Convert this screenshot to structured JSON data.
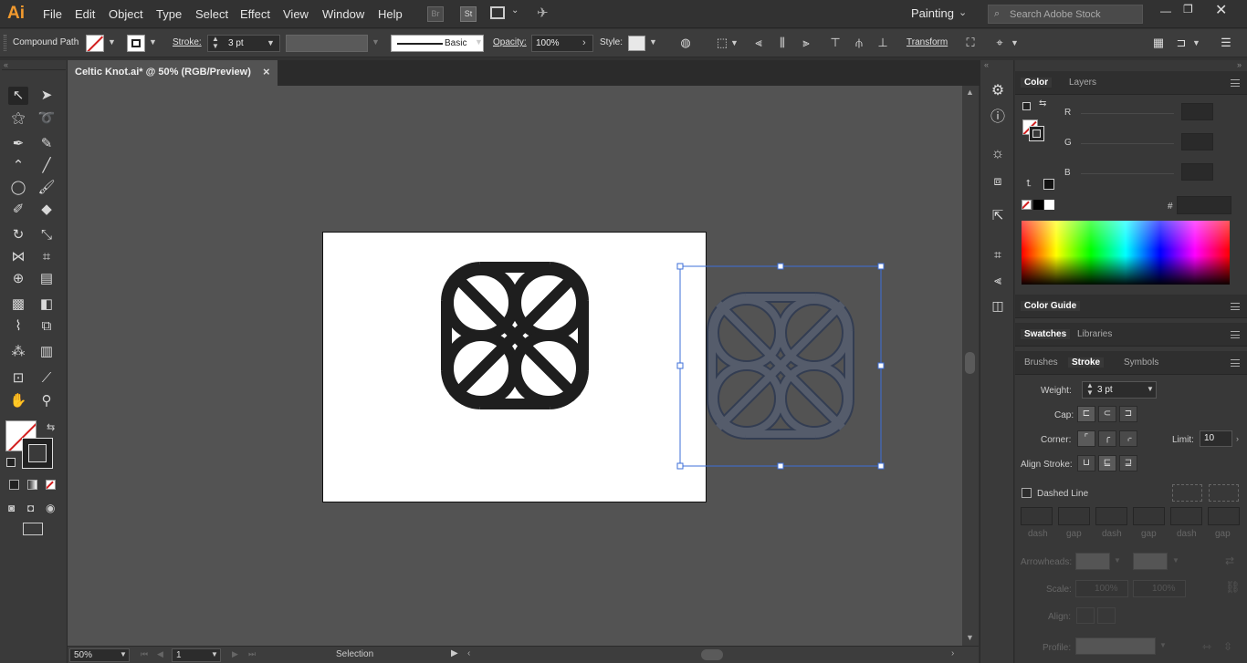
{
  "menubar": {
    "app_logo": "Ai",
    "items": [
      "File",
      "Edit",
      "Object",
      "Type",
      "Select",
      "Effect",
      "View",
      "Window",
      "Help"
    ],
    "workspace": "Painting",
    "stock_search_placeholder": "Search Adobe Stock"
  },
  "controlbar": {
    "selection_type": "Compound Path",
    "stroke_label": "Stroke:",
    "stroke_weight": "3 pt",
    "brush_profile": "Basic",
    "opacity_label": "Opacity:",
    "opacity_value": "100%",
    "style_label": "Style:",
    "transform_label": "Transform"
  },
  "document": {
    "tab_title": "Celtic Knot.ai* @ 50% (RGB/Preview)",
    "close_glyph": "×"
  },
  "statusbar": {
    "zoom": "50%",
    "artboard_number": "1",
    "status_text": "Selection"
  },
  "color_panel": {
    "tabs": [
      "Color",
      "Layers"
    ],
    "channels": [
      "R",
      "G",
      "B"
    ],
    "hex_label": "#"
  },
  "color_guide_panel": {
    "title": "Color Guide"
  },
  "swatches_panel": {
    "tabs": [
      "Swatches",
      "Libraries"
    ]
  },
  "stroke_panel": {
    "tabs": [
      "Brushes",
      "Stroke",
      "Symbols"
    ],
    "weight_label": "Weight:",
    "weight_value": "3 pt",
    "cap_label": "Cap:",
    "corner_label": "Corner:",
    "limit_label": "Limit:",
    "limit_value": "10",
    "align_label": "Align Stroke:",
    "dashed_label": "Dashed Line",
    "dash_gap_labels": [
      "dash",
      "gap",
      "dash",
      "gap",
      "dash",
      "gap"
    ],
    "arrowheads_label": "Arrowheads:",
    "scale_label": "Scale:",
    "scale_values": [
      "100%",
      "100%"
    ],
    "align_arrow_label": "Align:",
    "profile_label": "Profile:"
  },
  "colors": {
    "accent_logo": "#f29a2e",
    "selection_blue": "#3d6fd8",
    "knot_black": "#1e1e1e"
  }
}
